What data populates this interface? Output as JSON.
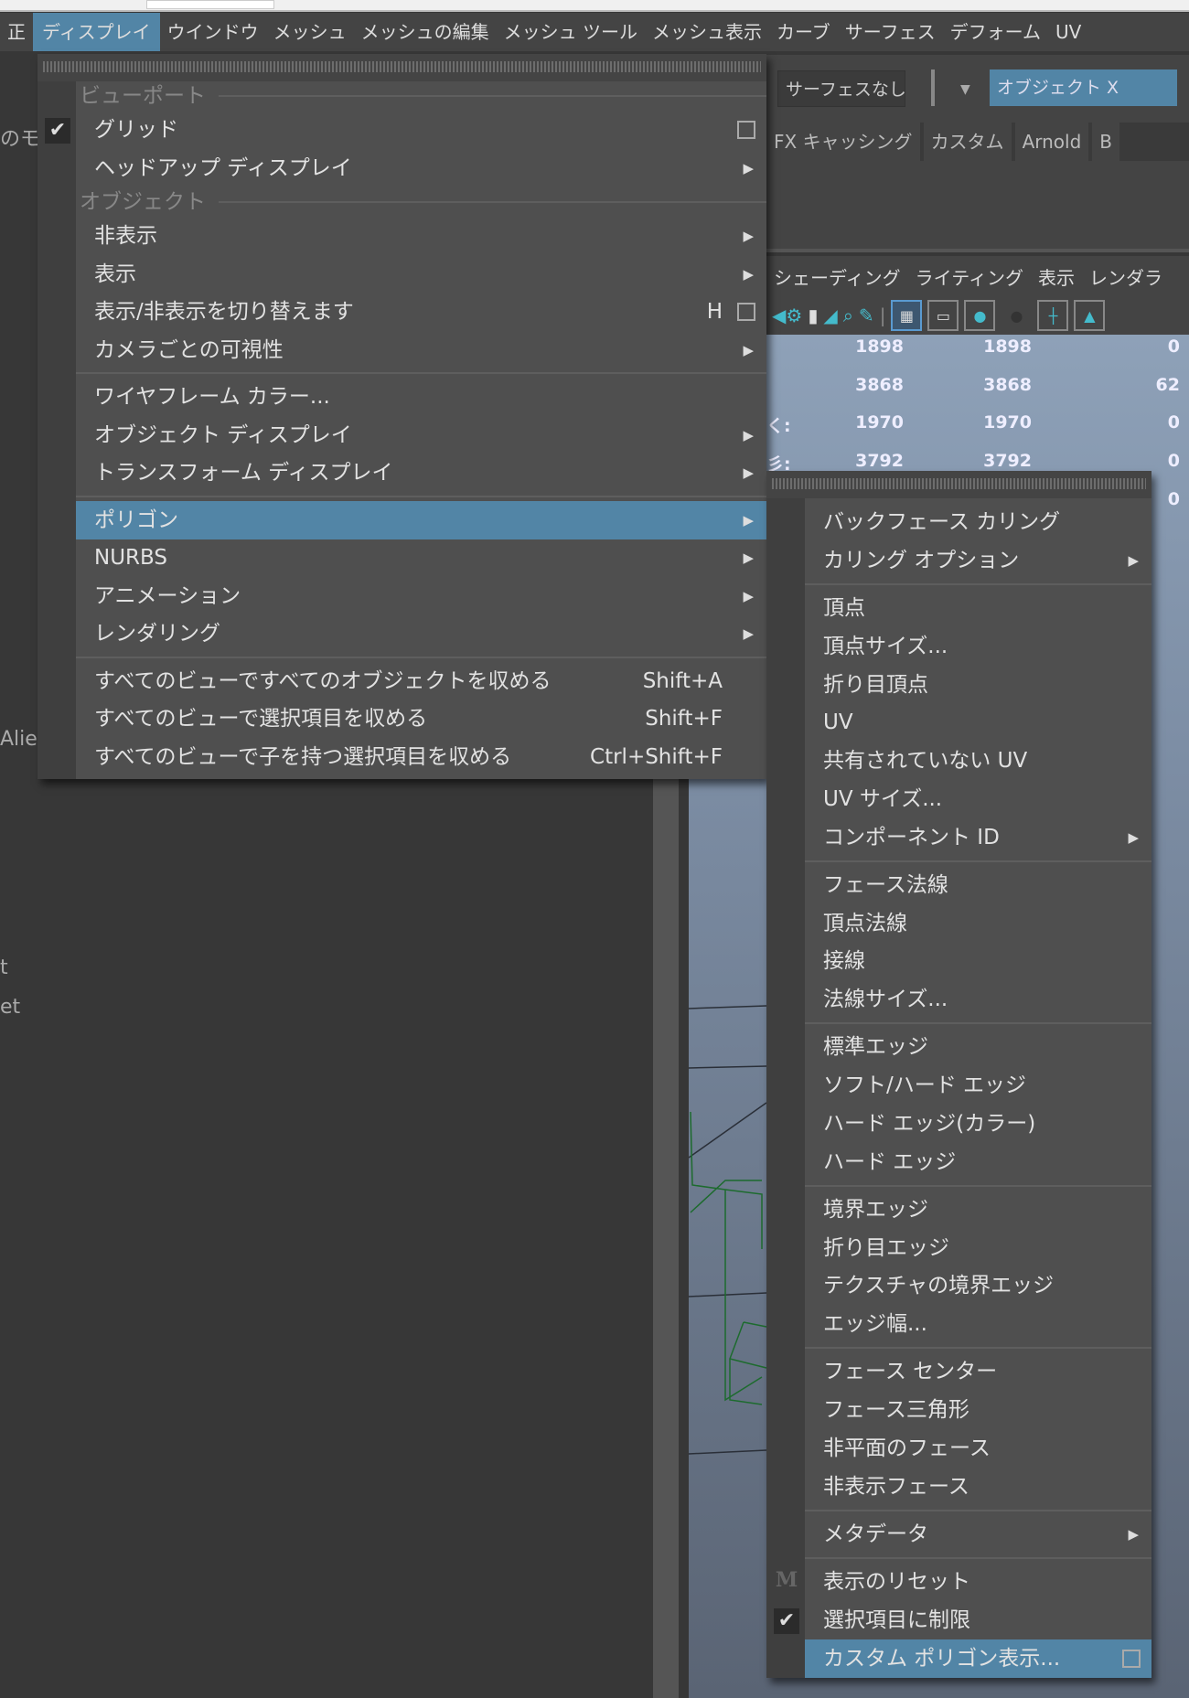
{
  "menubar": {
    "items": [
      "正",
      "ディスプレイ",
      "ウインドウ",
      "メッシュ",
      "メッシュの編集",
      "メッシュ ツール",
      "メッシュ表示",
      "カーブ",
      "サーフェス",
      "デフォーム",
      "UV"
    ],
    "active": 1
  },
  "toolbar": {
    "surface_field": "サーフェスなし",
    "object_field": "オブジェクト X"
  },
  "shelf_tabs": [
    "FX キャッシング",
    "カスタム",
    "Arnold",
    "B"
  ],
  "panel_menu": [
    "シェーディング",
    "ライティング",
    "表示",
    "レンダラ"
  ],
  "hud": {
    "rows": [
      [
        "1898",
        "1898",
        "0"
      ],
      [
        "3868",
        "3868",
        "62"
      ],
      [
        "1970",
        "1970",
        "0"
      ],
      [
        "3792",
        "3792",
        "0"
      ],
      [
        "",
        "",
        "0"
      ]
    ],
    "labels": [
      "",
      "",
      "く:",
      "彡:",
      ""
    ]
  },
  "left_panel": {
    "texts": [
      "のモ",
      "Alie",
      "t",
      "et"
    ]
  },
  "accent_color": "#5285a6",
  "display_menu": {
    "entries": [
      {
        "type": "header",
        "label": "ビューポート"
      },
      {
        "type": "item",
        "label": "グリッド",
        "checked": true,
        "option_box": true
      },
      {
        "type": "item",
        "label": "ヘッドアップ ディスプレイ",
        "submenu": true
      },
      {
        "type": "header",
        "label": "オブジェクト"
      },
      {
        "type": "item",
        "label": "非表示",
        "submenu": true
      },
      {
        "type": "item",
        "label": "表示",
        "submenu": true
      },
      {
        "type": "item",
        "label": "表示/非表示を切り替えます",
        "shortcut": "H",
        "option_box": true
      },
      {
        "type": "item",
        "label": "カメラごとの可視性",
        "submenu": true
      },
      {
        "type": "sep"
      },
      {
        "type": "item",
        "label": "ワイヤフレーム カラー..."
      },
      {
        "type": "item",
        "label": "オブジェクト ディスプレイ",
        "submenu": true
      },
      {
        "type": "item",
        "label": "トランスフォーム ディスプレイ",
        "submenu": true
      },
      {
        "type": "sep"
      },
      {
        "type": "item",
        "label": "ポリゴン",
        "submenu": true,
        "highlighted": true
      },
      {
        "type": "item",
        "label": "NURBS",
        "submenu": true
      },
      {
        "type": "item",
        "label": "アニメーション",
        "submenu": true
      },
      {
        "type": "item",
        "label": "レンダリング",
        "submenu": true
      },
      {
        "type": "sep"
      },
      {
        "type": "item",
        "label": "すべてのビューですべてのオブジェクトを収める",
        "shortcut": "Shift+A"
      },
      {
        "type": "item",
        "label": "すべてのビューで選択項目を収める",
        "shortcut": "Shift+F"
      },
      {
        "type": "item",
        "label": "すべてのビューで子を持つ選択項目を収める",
        "shortcut": "Ctrl+Shift+F"
      }
    ]
  },
  "polygon_submenu": {
    "entries": [
      {
        "type": "item",
        "label": "バックフェース カリング"
      },
      {
        "type": "item",
        "label": "カリング オプション",
        "submenu": true
      },
      {
        "type": "sep"
      },
      {
        "type": "item",
        "label": "頂点"
      },
      {
        "type": "item",
        "label": "頂点サイズ..."
      },
      {
        "type": "item",
        "label": "折り目頂点"
      },
      {
        "type": "item",
        "label": "UV"
      },
      {
        "type": "item",
        "label": "共有されていない UV"
      },
      {
        "type": "item",
        "label": "UV サイズ..."
      },
      {
        "type": "item",
        "label": "コンポーネント ID",
        "submenu": true
      },
      {
        "type": "sep"
      },
      {
        "type": "item",
        "label": "フェース法線"
      },
      {
        "type": "item",
        "label": "頂点法線"
      },
      {
        "type": "item",
        "label": "接線"
      },
      {
        "type": "item",
        "label": "法線サイズ..."
      },
      {
        "type": "sep"
      },
      {
        "type": "item",
        "label": "標準エッジ"
      },
      {
        "type": "item",
        "label": "ソフト/ハード エッジ"
      },
      {
        "type": "item",
        "label": "ハード エッジ(カラー)"
      },
      {
        "type": "item",
        "label": "ハード エッジ"
      },
      {
        "type": "sep"
      },
      {
        "type": "item",
        "label": "境界エッジ"
      },
      {
        "type": "item",
        "label": "折り目エッジ"
      },
      {
        "type": "item",
        "label": "テクスチャの境界エッジ"
      },
      {
        "type": "item",
        "label": "エッジ幅..."
      },
      {
        "type": "sep"
      },
      {
        "type": "item",
        "label": "フェース センター"
      },
      {
        "type": "item",
        "label": "フェース三角形"
      },
      {
        "type": "item",
        "label": "非平面のフェース"
      },
      {
        "type": "item",
        "label": "非表示フェース"
      },
      {
        "type": "sep"
      },
      {
        "type": "item",
        "label": "メタデータ",
        "submenu": true
      },
      {
        "type": "sep"
      },
      {
        "type": "item",
        "label": "表示のリセット",
        "gutter_mark": "M"
      },
      {
        "type": "item",
        "label": "選択項目に制限",
        "checked": true
      },
      {
        "type": "item",
        "label": "カスタム ポリゴン表示...",
        "option_box": true,
        "highlighted": true
      }
    ]
  }
}
